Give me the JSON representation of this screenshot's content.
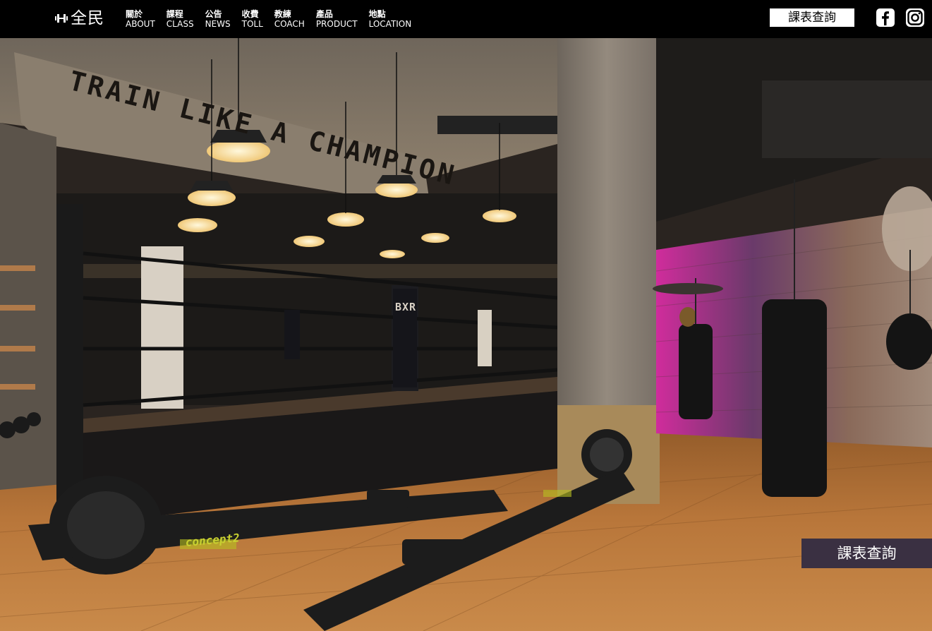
{
  "brand": {
    "name": "全民",
    "logo_icon": "dumbbell-icon"
  },
  "nav": {
    "items": [
      {
        "zh": "關於",
        "en": "ABOUT"
      },
      {
        "zh": "課程",
        "en": "CLASS"
      },
      {
        "zh": "公告",
        "en": "NEWS"
      },
      {
        "zh": "收費",
        "en": "TOLL"
      },
      {
        "zh": "教練",
        "en": "COACH"
      },
      {
        "zh": "產品",
        "en": "PRODUCT"
      },
      {
        "zh": "地點",
        "en": "LOCATION"
      }
    ]
  },
  "header": {
    "schedule_label": "課表查詢"
  },
  "social": {
    "facebook_icon": "facebook-icon",
    "instagram_icon": "instagram-icon"
  },
  "hero": {
    "wall_text": "TRAIN LIKE A CHAMPION",
    "banner_text": "BXR",
    "rower_brand": "concept2",
    "floating_schedule_label": "課表查詢"
  },
  "colors": {
    "topbar": "#000000",
    "floating_button": "#3a3042",
    "schedule_button": "#ffffff"
  }
}
